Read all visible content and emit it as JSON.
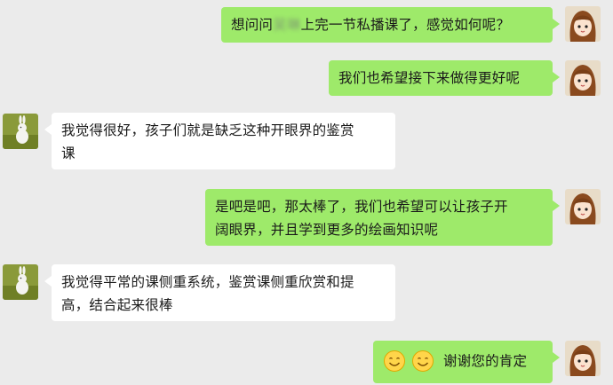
{
  "conversation": {
    "messages": [
      {
        "sender": "self",
        "parts": {
          "before": "想问问",
          "redacted": "吴琳",
          "after": "上完一节私播课了，感觉如何呢？"
        }
      },
      {
        "sender": "self",
        "text": "我们也希望接下来做得更好呢"
      },
      {
        "sender": "other",
        "lines": [
          "我觉得很好，孩子们就是缺乏这种开眼界的鉴赏",
          "课"
        ]
      },
      {
        "sender": "self",
        "lines": [
          "是吧是吧，那太棒了，我们也希望可以让孩子开",
          "阔眼界，并且学到更多的绘画知识呢"
        ]
      },
      {
        "sender": "other",
        "lines": [
          "我觉得平常的课侧重系统，鉴赏课侧重欣赏和提",
          "高，结合起来很棒"
        ]
      },
      {
        "sender": "self",
        "emoji_icons": [
          "smiley-icon",
          "smiley-icon"
        ],
        "text": "谢谢您的肯定"
      }
    ]
  },
  "colors": {
    "background": "#ebebeb",
    "self_bubble": "#9eea6a",
    "other_bubble": "#ffffff"
  }
}
